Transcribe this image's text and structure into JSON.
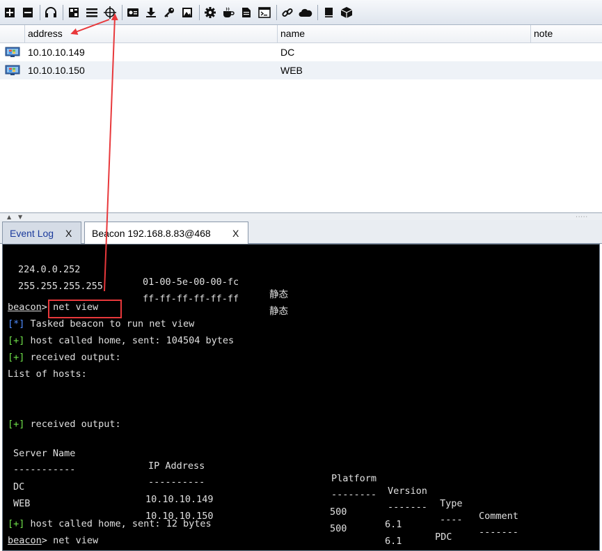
{
  "toolbar": {
    "icons": [
      "new-connection-icon",
      "disconnect-icon",
      "headphones-icon",
      "pivot-graph-icon",
      "session-list-icon",
      "target-crosshair-icon",
      "screenshot-icon",
      "download-icon",
      "credentials-key-icon",
      "image-icon",
      "settings-gear-icon",
      "coffee-cup-icon",
      "document-icon",
      "terminal-icon",
      "link-icon",
      "cloud-icon",
      "book-icon",
      "package-box-icon"
    ]
  },
  "targets_table": {
    "columns": [
      "address",
      "name",
      "note"
    ],
    "rows": [
      {
        "address": "10.10.10.149",
        "name": "DC",
        "note": ""
      },
      {
        "address": "10.10.10.150",
        "name": "WEB",
        "note": ""
      }
    ]
  },
  "tabs": [
    {
      "label": "Event Log",
      "close": "X"
    },
    {
      "label": "Beacon 192.168.8.83@468",
      "close": "X"
    }
  ],
  "console": {
    "arp_rows": [
      {
        "ip": "224.0.0.252",
        "mac": "01-00-5e-00-00-fc",
        "type": "静态"
      },
      {
        "ip": "255.255.255.255",
        "mac": "ff-ff-ff-ff-ff-ff",
        "type": "静态"
      }
    ],
    "prompt": "beacon",
    "prompt_sep": ">",
    "command": "net view",
    "task_tag": "[*]",
    "task_text": "Tasked beacon to run net view",
    "plus_tag": "[+]",
    "called_home_1": "host called home, sent: 104504 bytes",
    "received_1": "received output:",
    "list_hosts": "List of hosts:",
    "received_2": "received output:",
    "headers": [
      "Server Name",
      "IP Address",
      "Platform",
      "Version",
      "Type",
      "Comment"
    ],
    "dashes": [
      "-----------",
      "----------",
      "--------",
      "-------",
      "----",
      "-------"
    ],
    "hosts": [
      {
        "server": "DC",
        "ip": "10.10.10.149",
        "platform": "500",
        "version": "6.1",
        "type": "PDC",
        "comment": ""
      },
      {
        "server": "WEB",
        "ip": "10.10.10.150",
        "platform": "500",
        "version": "6.1",
        "type": "",
        "comment": ""
      }
    ],
    "called_home_2": "host called home, sent: 12 bytes",
    "final_command": "net view"
  },
  "colors": {
    "annotation_red": "#e8383b",
    "console_bg": "#000000",
    "tag_blue": "#4f8cff",
    "tag_green": "#6fe04a"
  }
}
